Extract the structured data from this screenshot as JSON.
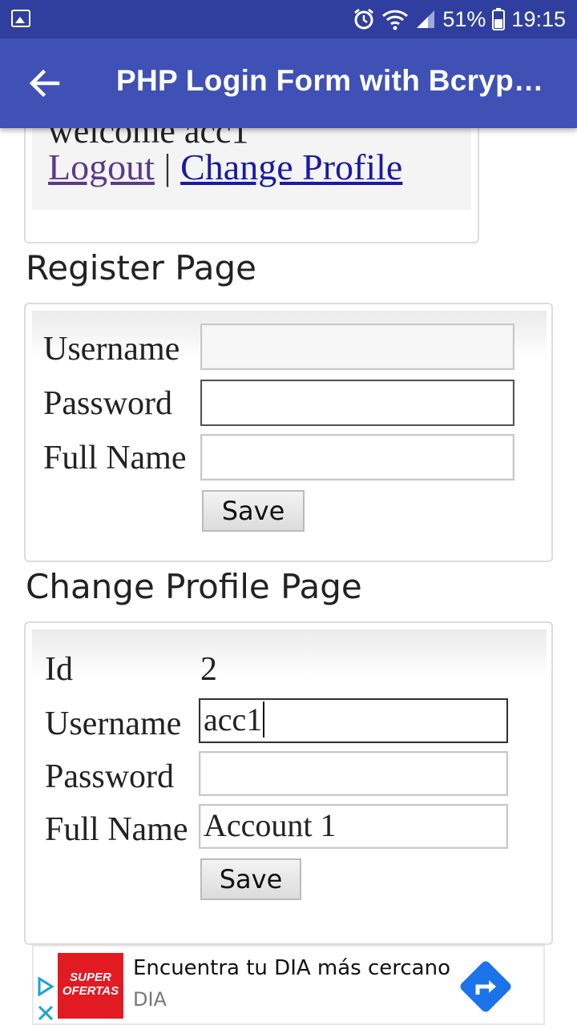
{
  "status": {
    "battery": "51%",
    "time": "19:15"
  },
  "appbar": {
    "title": "PHP Login Form with Bcryp…"
  },
  "top_card": {
    "welcome": "welcome acc1",
    "logout": "Logout",
    "separator": "|",
    "change_profile": "Change Profile"
  },
  "register": {
    "heading": "Register Page",
    "username_label": "Username",
    "password_label": "Password",
    "fullname_label": "Full Name",
    "save": "Save"
  },
  "change_profile": {
    "heading": "Change Profile Page",
    "id_label": "Id",
    "id_value": "2",
    "username_label": "Username",
    "username_value": "acc1",
    "password_label": "Password",
    "fullname_label": "Full Name",
    "fullname_value": "Account 1",
    "save": "Save"
  },
  "ad": {
    "thumb_text": "SUPER OFERTAS",
    "headline": "Encuentra tu DIA más cercano",
    "advertiser": "DIA"
  },
  "colors": {
    "statusbar": "#303f9f",
    "appbar": "#3f51b5",
    "link": "#1a1aa6",
    "ad_accent": "#1a73e8"
  }
}
